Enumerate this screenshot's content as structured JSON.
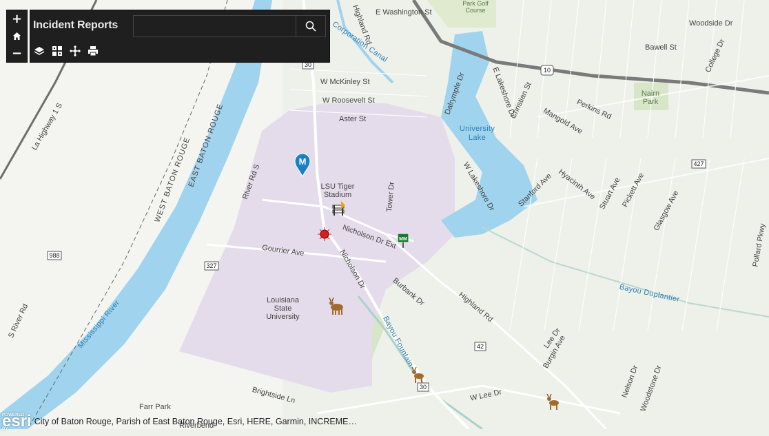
{
  "app": {
    "title": "Incident Reports",
    "search": {
      "value": "",
      "placeholder": ""
    },
    "zoom_in_label": "+",
    "zoom_out_label": "−",
    "tools": [
      "layers-icon",
      "basemap-gallery-icon",
      "measure-icon",
      "print-icon"
    ]
  },
  "attribution": {
    "logo_text": "esri",
    "powered_by": "POWERED BY",
    "text": "City of Baton Rouge, Parish of East Baton Rouge, Esri, HERE, Garmin, INCREME…"
  },
  "map_labels": {
    "streets": [
      "E Washington St",
      "Highland Rd",
      "W McKinley St",
      "W Roosevelt St",
      "Aster St",
      "River Rd S",
      "Nicholson Dr Ext",
      "Nicholson Dr",
      "Gourrier Ave",
      "Tower Dr",
      "Burbank Dr",
      "Highland Rd",
      "W Lakeshore Dr",
      "Dalrymple Dr",
      "E Lakeshore Dr",
      "Christian St",
      "Perkins Rd",
      "Mangold Ave",
      "Woodside Dr",
      "Bawell St",
      "College Dr",
      "Stanford Ave",
      "Hyacinth Ave",
      "Stuart Ave",
      "Pickett Ave",
      "Glasgow Ave",
      "Lee Dr",
      "Burgin Ave",
      "Nelson Dr",
      "Woodstone Dr",
      "W Lee Dr",
      "Brightside Ln",
      "La Highway 1 S",
      "S River Rd",
      "Pollard Pkwy"
    ],
    "places": [
      "LSU Tiger Stadium",
      "Louisiana State University",
      "University Lake",
      "Nairn Park",
      "Park Golf Course",
      "Farr Park",
      "Riverbend",
      "WEST BATON ROUGE",
      "EAST BATON ROUGE"
    ],
    "water": [
      "Mississippi River",
      "Corporation Canal",
      "Bayou Fountain",
      "Bayou Duplantier"
    ],
    "shields": [
      "30",
      "10",
      "427",
      "988",
      "327",
      "42",
      "30"
    ]
  },
  "colors": {
    "panel": "#1f1f1f",
    "water": "#9fd3ee",
    "campus": "#e4dcea",
    "park": "#d8e6c8",
    "marker_blue": "#1a7fc4",
    "marker_red": "#d91c1c"
  }
}
